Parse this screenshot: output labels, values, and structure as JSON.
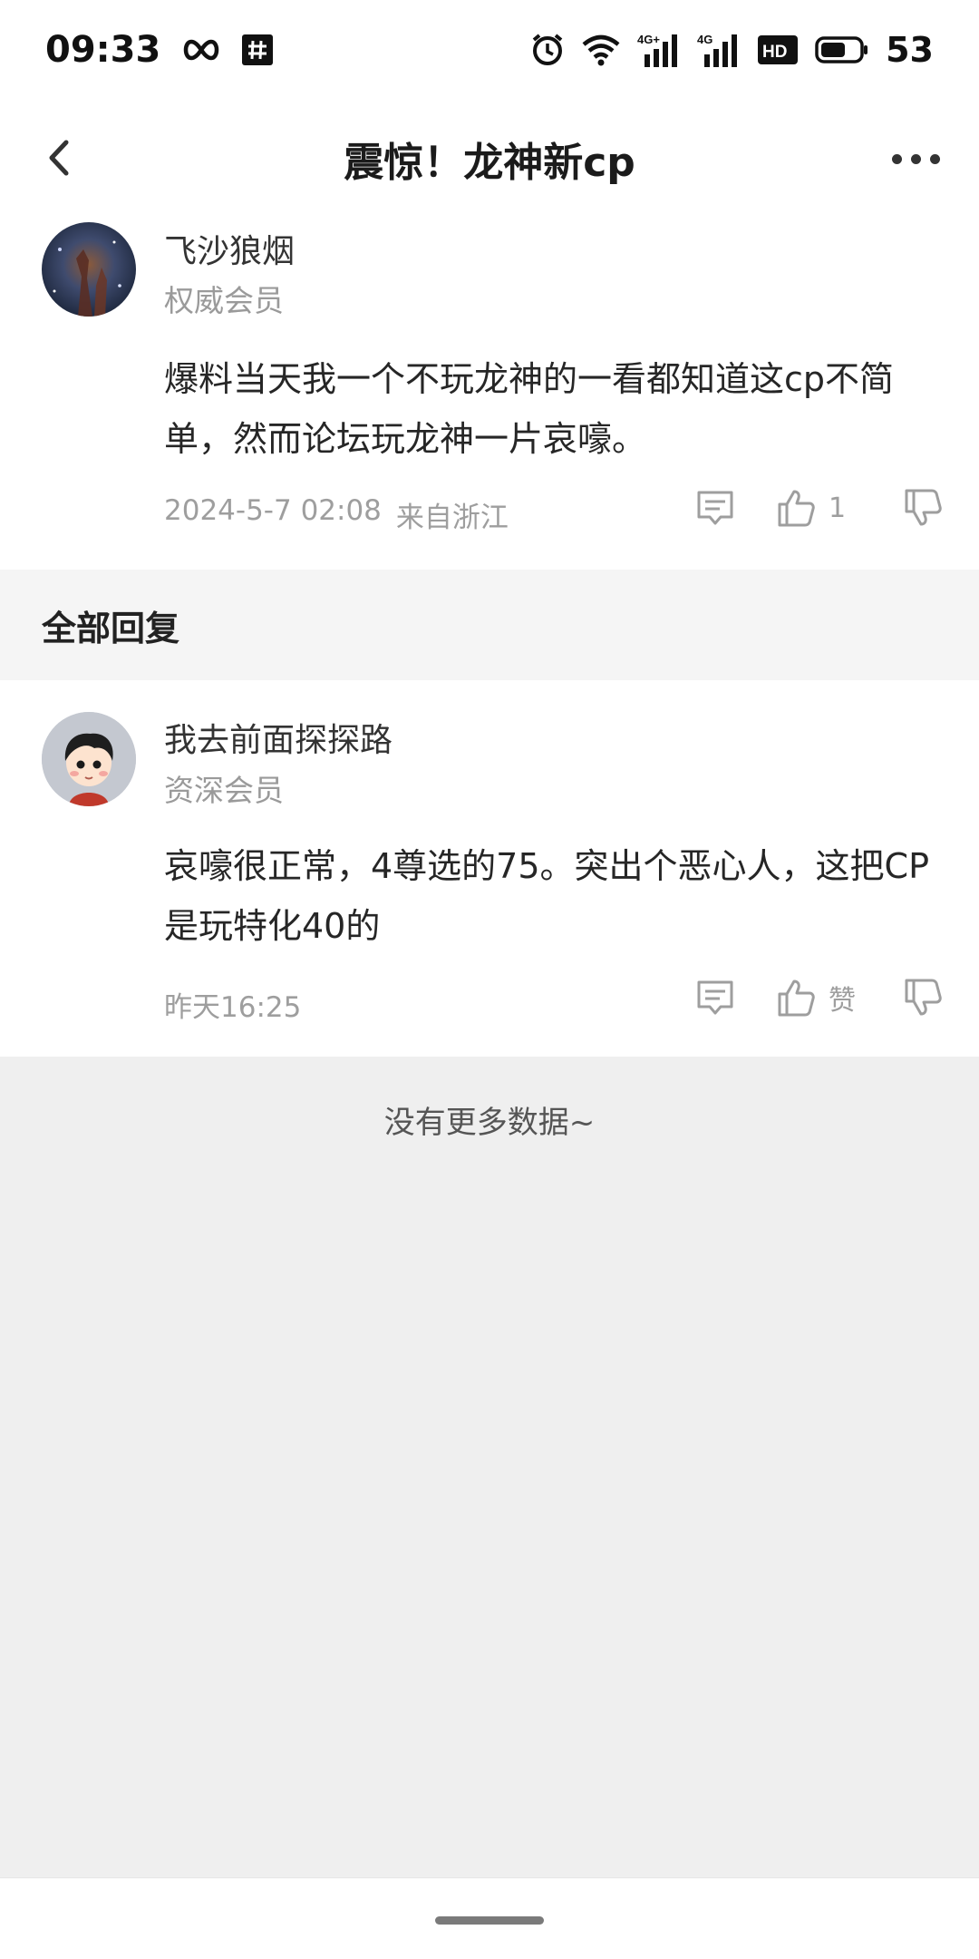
{
  "status_bar": {
    "time": "09:33",
    "battery_percent": "53",
    "icons": [
      "infinity-icon",
      "hashtag-app-icon",
      "alarm-icon",
      "wifi-icon",
      "signal-4g-plus-icon",
      "signal-4g-icon",
      "hd-icon",
      "battery-icon"
    ],
    "net_label_1": "4G+",
    "net_label_2": "4G",
    "hd_label": "HD"
  },
  "nav": {
    "title": "震惊！龙神新cp",
    "back_icon": "chevron-left-icon",
    "more_icon": "more-horizontal-icon"
  },
  "main_post": {
    "author": "飞沙狼烟",
    "member_level": "权威会员",
    "content": "爆料当天我一个不玩龙神的一看都知道这cp不简单，然而论坛玩龙神一片哀嚎。",
    "date": "2024-5-7 02:08",
    "location": "来自浙江",
    "like_count": "1"
  },
  "section": {
    "title": "全部回复"
  },
  "replies": [
    {
      "author": "我去前面探探路",
      "member_level": "资深会员",
      "content": "哀嚎很正常，4尊选的75。突出个恶心人，这把CP是玩特化40的",
      "date": "昨天16:25",
      "like_label": "赞"
    }
  ],
  "footer": {
    "no_more_text": "没有更多数据~"
  },
  "colors": {
    "background": "#efefef",
    "card": "#ffffff",
    "muted_text": "#9e9e9e"
  }
}
